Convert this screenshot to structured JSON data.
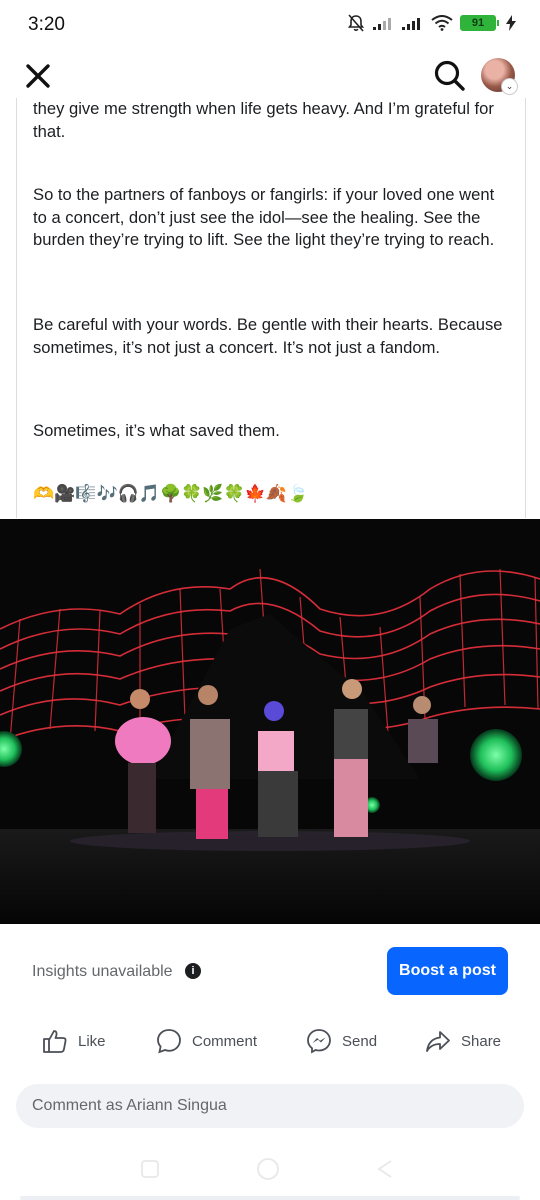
{
  "status_bar": {
    "time": "3:20",
    "battery": "91",
    "icons": [
      "mute-bell-icon",
      "signal-icon",
      "signal-icon",
      "wifi-icon",
      "battery-icon",
      "charging-bolt-icon"
    ]
  },
  "header": {
    "close_icon": "close-icon",
    "search_icon": "search-icon",
    "avatar_badge": "⌄"
  },
  "post": {
    "paragraphs": [
      "they give me strength when life gets heavy. And I’m grateful for that.",
      "So to the partners of fanboys or fangirls: if your loved one went to a concert, don’t just see the idol—see the healing. See the burden they’re trying to lift. See the light they’re trying to reach.",
      "Be careful with your words. Be gentle with their hearts. Because sometimes, it’s not just a concert. It’s not just a fandom.",
      "Sometimes, it’s what saved them."
    ],
    "emojis": "🫶🎥🎼🎶🎧🎵🌳🍀🌿🍀🍁🍂🍃"
  },
  "insights": {
    "text": "Insights unavailable",
    "info_icon": "i",
    "boost_label": "Boost a post"
  },
  "actions": {
    "like": "Like",
    "comment": "Comment",
    "send": "Send",
    "share": "Share"
  },
  "comment_input": {
    "placeholder": "Comment as Ariann Singua"
  },
  "colors": {
    "accent": "#0866ff",
    "battery": "#2fb33a",
    "input_bg": "#f0f2f5",
    "muted_text": "#65676b"
  }
}
